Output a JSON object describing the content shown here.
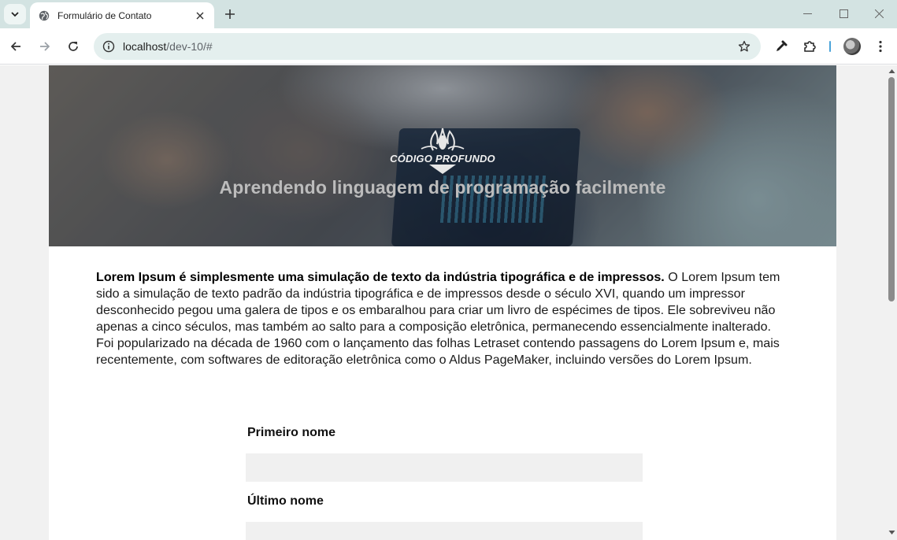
{
  "browser": {
    "tab_title": "Formulário de Contato",
    "url_host": "localhost",
    "url_path": "/dev-10/#",
    "icons": [
      "tab-search-icon",
      "globe-icon",
      "close-icon",
      "plus-icon",
      "minimize-icon",
      "maximize-icon",
      "window-close-icon",
      "back-icon",
      "forward-icon",
      "reload-icon",
      "site-info-icon",
      "star-icon",
      "eyedropper-icon",
      "extensions-icon",
      "profile-avatar",
      "menu-icon"
    ]
  },
  "hero": {
    "logo_name": "CÓDIGO PROFUNDO",
    "title": "Aprendendo linguagem de programação facilmente"
  },
  "intro": {
    "bold": "Lorem Ipsum é simplesmente uma simulação de texto da indústria tipográfica e de impressos.",
    "text": " O Lorem Ipsum tem sido a simulação de texto padrão da indústria tipográfica e de impressos desde o século XVI, quando um impressor desconhecido pegou uma galera de tipos e os embaralhou para criar um livro de espécimes de tipos. Ele sobreviveu não apenas a cinco séculos, mas também ao salto para a composição eletrônica, permanecendo essencialmente inalterado. Foi popularizado na década de 1960 com o lançamento das folhas Letraset contendo passagens do Lorem Ipsum e, mais recentemente, com softwares de editoração eletrônica como o Aldus PageMaker, incluindo versões do Lorem Ipsum."
  },
  "form": {
    "first_name_label": "Primeiro nome",
    "first_name_value": "",
    "last_name_label": "Último nome",
    "last_name_value": ""
  }
}
